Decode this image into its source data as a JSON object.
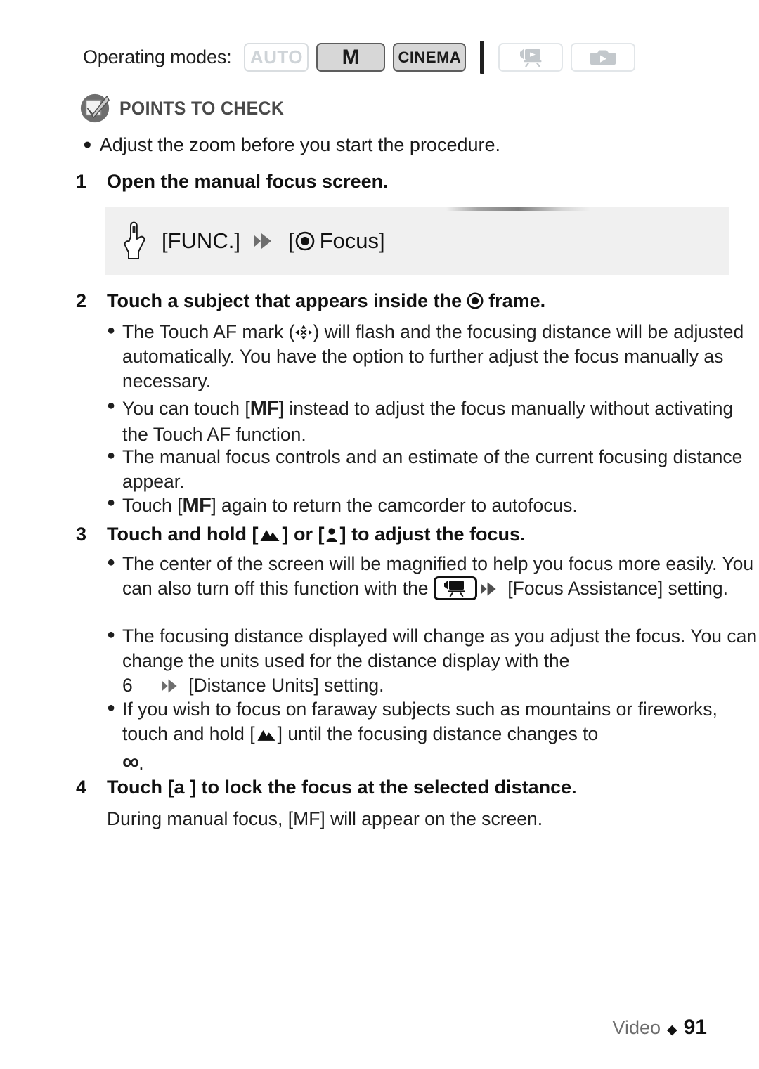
{
  "operating_modes": {
    "label": "Operating modes:",
    "badges": [
      {
        "text": "AUTO",
        "state": "off",
        "icon": null
      },
      {
        "text": "M",
        "state": "on",
        "icon": null
      },
      {
        "text": "CINEMA",
        "state": "on",
        "icon": null
      }
    ],
    "icon_badges": [
      {
        "icon": "movie-camera-playback-icon",
        "state": "off"
      },
      {
        "icon": "photo-camera-playback-icon",
        "state": "off"
      }
    ]
  },
  "points_to_check": {
    "icon": "checkbox-check-circle-icon",
    "title": "POINTS TO CHECK",
    "bullets": [
      "Adjust the zoom before you start the procedure."
    ]
  },
  "steps": [
    {
      "number": "1",
      "heading": "Open the manual focus screen.",
      "procedure": {
        "hand_icon": "pointing-hand-icon",
        "first": "[FUNC.]",
        "arrow_icon": "double-chevron-right-icon",
        "focus_icon": "focus-target-icon",
        "second": "Focus]",
        "open_bracket": "["
      }
    },
    {
      "number": "2",
      "heading_before": "Touch a subject that appears inside the",
      "heading_icon": "focus-target-icon",
      "heading_after": "frame.",
      "bullets": [
        {
          "parts": [
            {
              "t": "text",
              "v": "The Touch AF mark ("
            },
            {
              "t": "icon",
              "v": "touch-af-mark-icon"
            },
            {
              "t": "text",
              "v": ") will flash and the focusing distance will be adjusted automatically. You have the option to further adjust the focus manually as necessary."
            }
          ]
        },
        {
          "parts": [
            {
              "t": "text",
              "v": "You can touch ["
            },
            {
              "t": "mf",
              "v": "MF"
            },
            {
              "t": "text",
              "v": "] instead to adjust the focus manually without activating the Touch AF function."
            }
          ]
        },
        {
          "parts": [
            {
              "t": "text",
              "v": "The manual focus controls and an estimate of the current focusing distance appear."
            }
          ]
        },
        {
          "parts": [
            {
              "t": "text",
              "v": "Touch ["
            },
            {
              "t": "mf",
              "v": "MF"
            },
            {
              "t": "text",
              "v": "] again to return the camcorder to autofocus."
            }
          ]
        }
      ]
    },
    {
      "number": "3",
      "heading_parts": [
        {
          "t": "text",
          "v": "Touch and hold ["
        },
        {
          "t": "icon",
          "v": "mountain-far-focus-icon"
        },
        {
          "t": "text",
          "v": "] or ["
        },
        {
          "t": "icon",
          "v": "person-near-focus-icon"
        },
        {
          "t": "text",
          "v": "] to adjust the focus."
        }
      ],
      "bullets": [
        {
          "parts": [
            {
              "t": "text",
              "v": "The center of the screen will be magnified to help you focus more easily. You can also turn off this function with the "
            },
            {
              "t": "boxicon",
              "v": "camcorder-menu-icon"
            },
            {
              "t": "icon",
              "v": "double-chevron-right-icon"
            },
            {
              "t": "text",
              "v": " [Focus Assistance] setting."
            }
          ]
        },
        {
          "parts": [
            {
              "t": "text",
              "v": "The focusing distance displayed will change as you adjust the focus. You can change the units used for the distance display with the"
            },
            {
              "t": "break",
              "v": ""
            },
            {
              "t": "text",
              "v": "6"
            },
            {
              "t": "gap",
              "v": ""
            },
            {
              "t": "icon",
              "v": "double-chevron-right-icon"
            },
            {
              "t": "text",
              "v": " [Distance Units] setting."
            }
          ]
        },
        {
          "parts": [
            {
              "t": "text",
              "v": "If you wish to focus on faraway subjects such as mountains or fireworks, touch and hold ["
            },
            {
              "t": "icon",
              "v": "mountain-far-focus-icon"
            },
            {
              "t": "text",
              "v": "] until the focusing distance changes to"
            },
            {
              "t": "break",
              "v": ""
            },
            {
              "t": "inf",
              "v": "∞"
            },
            {
              "t": "text",
              "v": "."
            }
          ]
        }
      ]
    },
    {
      "number": "4",
      "heading": "Touch [a  ] to lock the focus at the selected distance.",
      "note": "During manual focus, [MF] will appear on the screen."
    }
  ],
  "footer": {
    "section": "Video",
    "separator": "◆",
    "page": "91"
  },
  "colors": {
    "badge_on_bg": "#d7d7d7",
    "badge_on_border": "#5d5d5d",
    "badge_off_border": "#d9dde0",
    "badge_off_text": "#cfd4d8",
    "proc_box_bg": "#f0f0f0",
    "ptc_title": "#4a4a4a",
    "arrow_gray": "#6e6e6e",
    "icon_gray": "#c3c8cc"
  }
}
